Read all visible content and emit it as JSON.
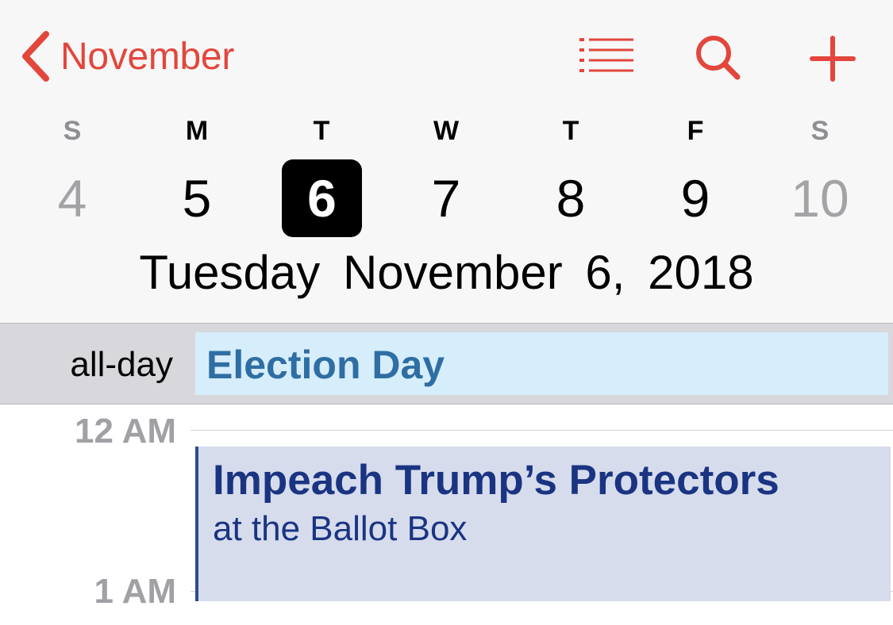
{
  "nav": {
    "back_label": "November",
    "accent_color": "#e2463c",
    "icons": [
      "chevron-left-icon",
      "list-icon",
      "search-icon",
      "plus-icon"
    ]
  },
  "week": {
    "days": [
      {
        "letter": "S",
        "number": "4",
        "weekend": true,
        "selected": false
      },
      {
        "letter": "M",
        "number": "5",
        "weekend": false,
        "selected": false
      },
      {
        "letter": "T",
        "number": "6",
        "weekend": false,
        "selected": true
      },
      {
        "letter": "W",
        "number": "7",
        "weekend": false,
        "selected": false
      },
      {
        "letter": "T",
        "number": "8",
        "weekend": false,
        "selected": false
      },
      {
        "letter": "F",
        "number": "9",
        "weekend": false,
        "selected": false
      },
      {
        "letter": "S",
        "number": "10",
        "weekend": true,
        "selected": false
      }
    ]
  },
  "date_title": "Tuesday November 6, 2018",
  "allday": {
    "label": "all-day",
    "event_title": "Election Day",
    "event_color": "#2f6ea3",
    "event_bg": "#d6edfc"
  },
  "timeline": {
    "hours": [
      "12 AM",
      "1 AM"
    ],
    "event": {
      "title": "Impeach Trump’s Protectors",
      "subtitle": "at the Ballot Box",
      "color": "#1a3482",
      "bg": "#d6dcec"
    }
  }
}
